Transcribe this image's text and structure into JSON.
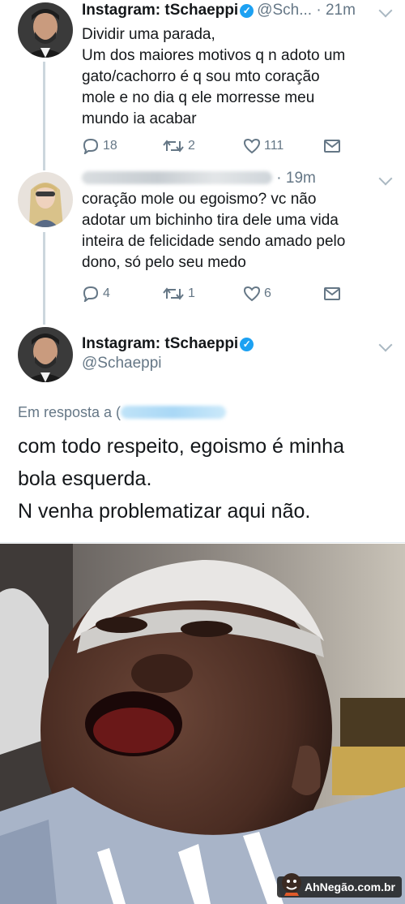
{
  "tweet1": {
    "name": "Instagram: tSchaeppi",
    "handle_time": "@Sch... · 21m",
    "lines": [
      "Dividir uma parada,",
      "Um dos maiores motivos q n adoto um",
      "gato/cachorro é q sou mto coração",
      "mole e no dia q ele morresse meu",
      "mundo ia acabar"
    ],
    "replies": "18",
    "retweets": "2",
    "likes": "111"
  },
  "tweet2": {
    "time": "· 19m",
    "lines": [
      "coração mole ou egoismo? vc não",
      "adotar um bichinho tira dele uma vida",
      "inteira de felicidade sendo amado pelo",
      "dono, só pelo seu medo"
    ],
    "replies": "4",
    "retweets": "1",
    "likes": "6"
  },
  "tweet3": {
    "name": "Instagram: tSchaeppi",
    "handle": "@Schaeppi",
    "reply_prefix": "Em resposta a (",
    "lines": [
      "com todo respeito, egoismo é minha",
      "bola esquerda.",
      "N venha problematizar aqui não."
    ]
  },
  "watermark": {
    "text": "AhNegão.com.br"
  },
  "colors": {
    "verified": "#1da1f2",
    "muted": "#657786",
    "line": "#ccd6dd"
  },
  "icons": [
    "verified-icon",
    "reply-icon",
    "retweet-icon",
    "like-icon",
    "dm-icon",
    "chevron-down-icon"
  ]
}
